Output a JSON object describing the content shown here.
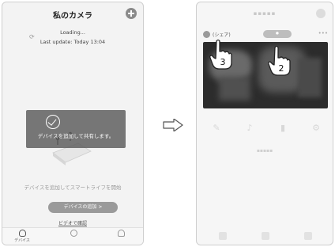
{
  "left_screen": {
    "title": "私のカメラ",
    "loading": "Loading...",
    "last_update": "Last update: Today 13:04",
    "overlay_message": "デバイスを追加して共有します。",
    "hint": "デバイスを追加してスマートライフを開始",
    "add_device_button": "デバイスの追加 >",
    "video_link": "ビデオで確認",
    "tabs": [
      {
        "label": "デバイス",
        "icon": "device-icon"
      },
      {
        "label": "",
        "icon": "smart-icon"
      },
      {
        "label": "",
        "icon": "profile-icon"
      }
    ]
  },
  "right_screen": {
    "share_label": "(シェア)",
    "callouts": [
      "3",
      "2"
    ]
  },
  "colors": {
    "overlay": "#5a5a5a",
    "button_gray": "#9a9a9a",
    "video_bg": "#2c2c2c"
  }
}
